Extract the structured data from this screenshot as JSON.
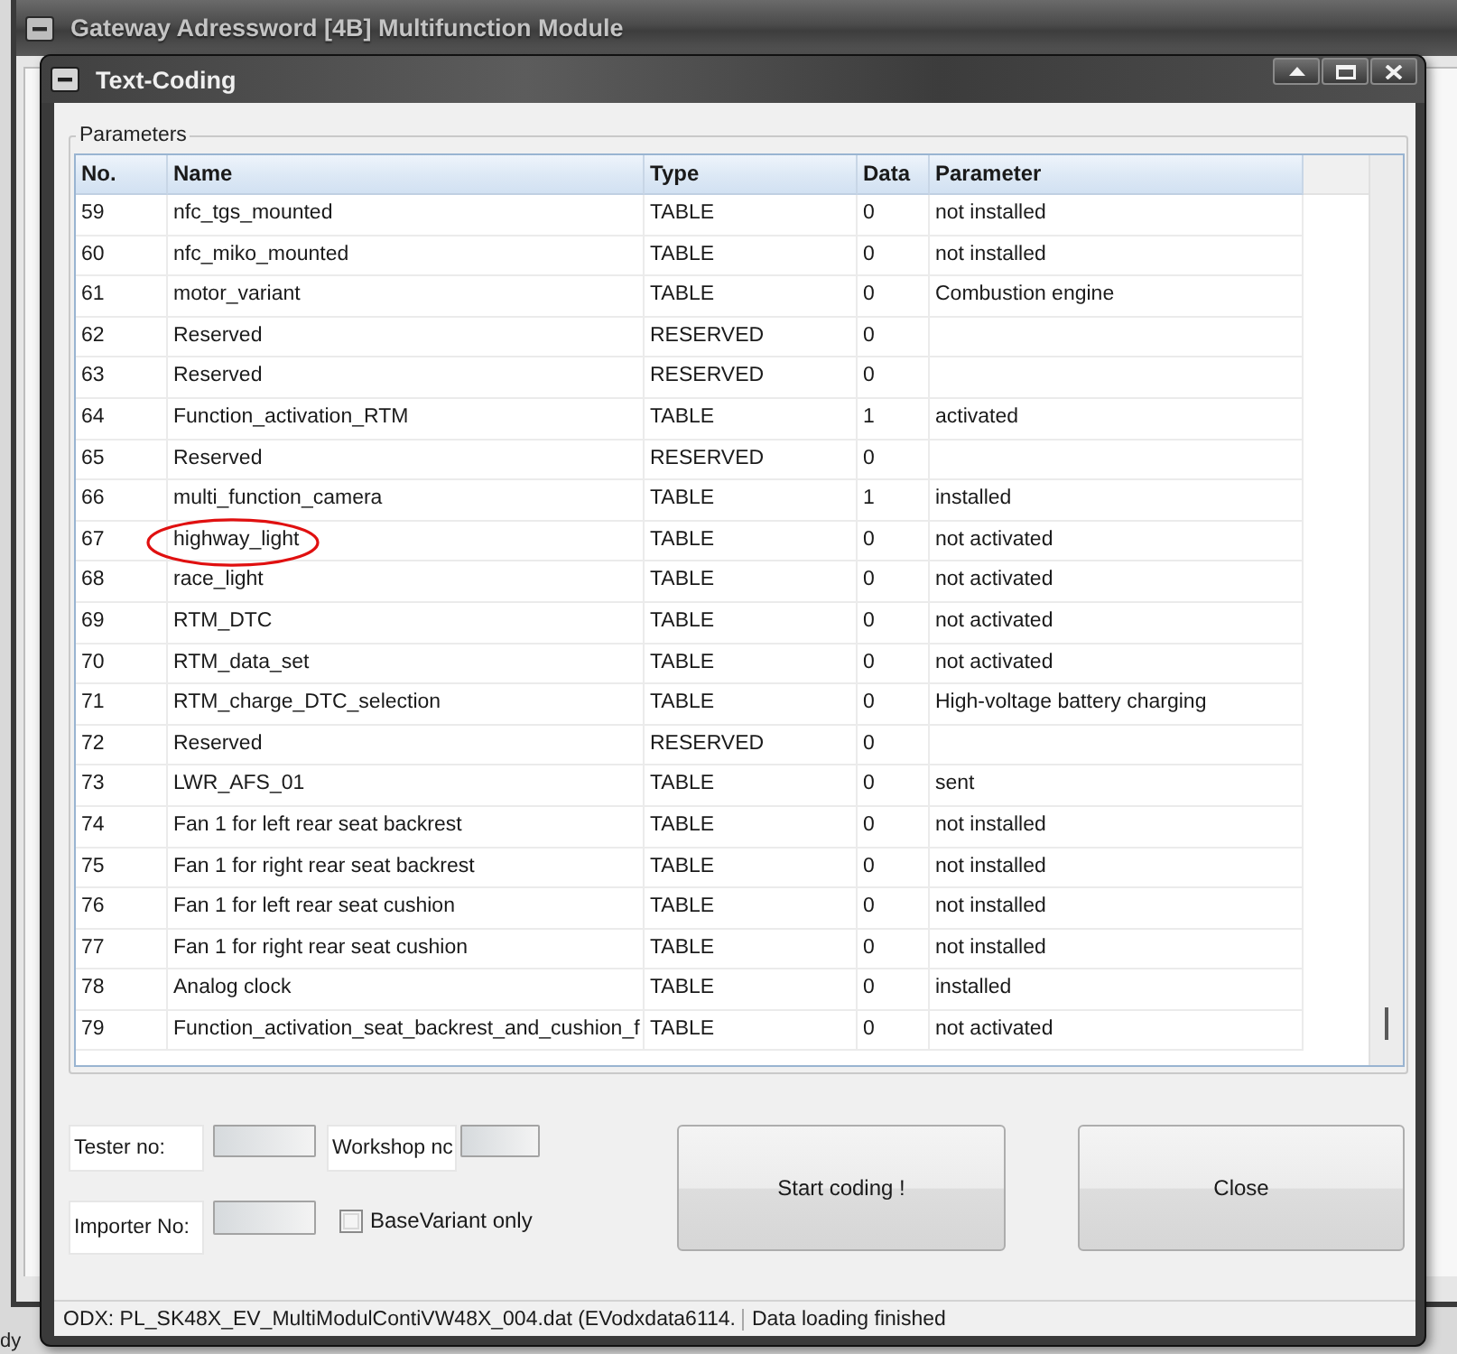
{
  "background_window": {
    "title": "Gateway Adressword [4B] Multifunction Module",
    "status_text": "dy"
  },
  "dialog": {
    "title": "Text-Coding"
  },
  "parameters": {
    "label": "Parameters",
    "columns": [
      "No.",
      "Name",
      "Type",
      "Data",
      "Parameter"
    ],
    "rows": [
      {
        "no": "59",
        "name": "nfc_tgs_mounted",
        "type": "TABLE",
        "data": "0",
        "parameter": "not installed",
        "circled": false
      },
      {
        "no": "60",
        "name": "nfc_miko_mounted",
        "type": "TABLE",
        "data": "0",
        "parameter": "not installed",
        "circled": false
      },
      {
        "no": "61",
        "name": "motor_variant",
        "type": "TABLE",
        "data": "0",
        "parameter": "Combustion engine",
        "circled": false
      },
      {
        "no": "62",
        "name": "Reserved",
        "type": "RESERVED",
        "data": "0",
        "circled": false
      },
      {
        "no": "63",
        "name": "Reserved",
        "type": "RESERVED",
        "data": "0",
        "circled": false
      },
      {
        "no": "64",
        "name": "Function_activation_RTM",
        "type": "TABLE",
        "data": "1",
        "parameter": "activated",
        "circled": false
      },
      {
        "no": "65",
        "name": "Reserved",
        "type": "RESERVED",
        "data": "0",
        "circled": false
      },
      {
        "no": "66",
        "name": "multi_function_camera",
        "type": "TABLE",
        "data": "1",
        "parameter": "installed",
        "circled": false
      },
      {
        "no": "67",
        "name": "highway_light",
        "type": "TABLE",
        "data": "0",
        "parameter": "not activated",
        "circled": true
      },
      {
        "no": "68",
        "name": "race_light",
        "type": "TABLE",
        "data": "0",
        "parameter": "not activated",
        "circled": false
      },
      {
        "no": "69",
        "name": "RTM_DTC",
        "type": "TABLE",
        "data": "0",
        "parameter": "not activated",
        "circled": false
      },
      {
        "no": "70",
        "name": "RTM_data_set",
        "type": "TABLE",
        "data": "0",
        "parameter": "not activated",
        "circled": false
      },
      {
        "no": "71",
        "name": "RTM_charge_DTC_selection",
        "type": "TABLE",
        "data": "0",
        "parameter": "High-voltage battery charging",
        "circled": false
      },
      {
        "no": "72",
        "name": "Reserved",
        "type": "RESERVED",
        "data": "0",
        "circled": false
      },
      {
        "no": "73",
        "name": "LWR_AFS_01",
        "type": "TABLE",
        "data": "0",
        "parameter": "sent",
        "circled": false
      },
      {
        "no": "74",
        "name": "Fan 1 for left rear seat backrest",
        "type": "TABLE",
        "data": "0",
        "parameter": "not installed",
        "circled": false
      },
      {
        "no": "75",
        "name": "Fan 1 for right rear seat backrest",
        "type": "TABLE",
        "data": "0",
        "parameter": "not installed",
        "circled": false
      },
      {
        "no": "76",
        "name": "Fan 1 for left rear seat cushion",
        "type": "TABLE",
        "data": "0",
        "parameter": "not installed",
        "circled": false
      },
      {
        "no": "77",
        "name": "Fan 1 for right rear seat cushion",
        "type": "TABLE",
        "data": "0",
        "parameter": "not installed",
        "circled": false
      },
      {
        "no": "78",
        "name": "Analog clock",
        "type": "TABLE",
        "data": "0",
        "parameter": "installed",
        "circled": false
      },
      {
        "no": "79",
        "name": "Function_activation_seat_backrest_and_cushion_f",
        "type": "TABLE",
        "data": "0",
        "parameter": "not activated",
        "circled": false
      }
    ]
  },
  "fields": [
    {
      "label": "Tester no:"
    },
    {
      "label": "Workshop nc"
    },
    {
      "label": "Importer No:"
    }
  ],
  "checkbox": {
    "label": "BaseVariant only",
    "checked": false
  },
  "buttons": [
    "Start coding !",
    "Close"
  ],
  "status_bar": [
    "ODX: PL_SK48X_EV_MultiModulContiVW48X_004.dat (EVodxdata6114.",
    "Data loading finished"
  ]
}
